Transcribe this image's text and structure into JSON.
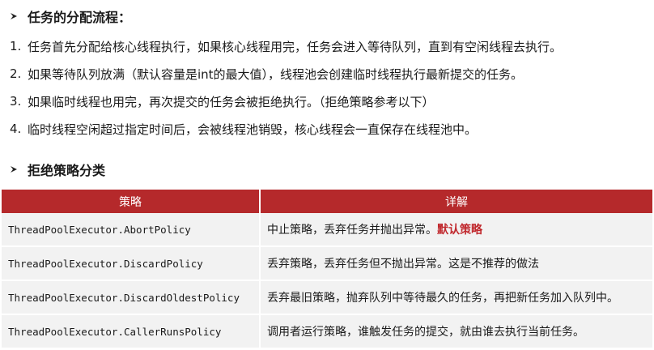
{
  "section1": {
    "title": "任务的分配流程：",
    "items": [
      {
        "num": "1.",
        "text": "任务首先分配给核心线程执行，如果核心线程用完，任务会进入等待队列，直到有空闲线程去执行。"
      },
      {
        "num": "2.",
        "text": "如果等待队列放满（默认容量是int的最大值），线程池会创建临时线程执行最新提交的任务。"
      },
      {
        "num": "3.",
        "text": "如果临时线程也用完，再次提交的任务会被拒绝执行。（拒绝策略参考以下）"
      },
      {
        "num": "4.",
        "text": "临时线程空闲超过指定时间后，会被线程池销毁，核心线程会一直保存在线程池中。"
      }
    ]
  },
  "section2": {
    "title": "拒绝策略分类"
  },
  "table": {
    "headers": [
      "策略",
      "详解"
    ],
    "rows": [
      {
        "policy": "ThreadPoolExecutor.AbortPolicy",
        "desc": "中止策略，丢弃任务并抛出异常。",
        "highlight": "默认策略"
      },
      {
        "policy": "ThreadPoolExecutor.DiscardPolicy",
        "desc": "丢弃策略，丢弃任务但不抛出异常。这是不推荐的做法",
        "highlight": ""
      },
      {
        "policy": "ThreadPoolExecutor.DiscardOldestPolicy",
        "desc": "丢弃最旧策略，抛弃队列中等待最久的任务，再把新任务加入队列中。",
        "highlight": ""
      },
      {
        "policy": "ThreadPoolExecutor.CallerRunsPolicy",
        "desc": "调用者运行策略，谁触发任务的提交，就由谁去执行当前任务。",
        "highlight": ""
      }
    ]
  },
  "colors": {
    "header_bg": "#b5292b",
    "row_bg": "#f2f2f2",
    "highlight": "#c0282d"
  },
  "icons": {
    "bullet": "arrow-bullet-icon"
  }
}
